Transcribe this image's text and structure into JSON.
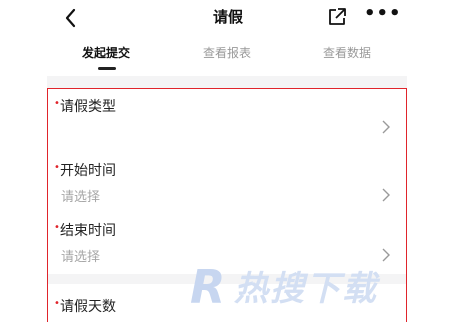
{
  "header": {
    "title": "请假",
    "back_icon": "chevron-left-icon",
    "share_icon": "share-external-icon",
    "more_label": "•••"
  },
  "tabs": [
    {
      "label": "发起提交",
      "active": true
    },
    {
      "label": "查看报表",
      "active": false
    },
    {
      "label": "查看数据",
      "active": false
    }
  ],
  "form": {
    "required_mark": "•",
    "fields": [
      {
        "label": "请假类型",
        "placeholder": ""
      },
      {
        "label": "开始时间",
        "placeholder": "请选择"
      },
      {
        "label": "结束时间",
        "placeholder": "请选择"
      },
      {
        "label": "请假天数",
        "placeholder": ""
      }
    ]
  },
  "watermark": {
    "letter": "R",
    "text": "热搜下载"
  },
  "colors": {
    "accent_red": "#e0242b",
    "placeholder_gray": "#a6a6a6",
    "background_gray": "#f4f4f5"
  }
}
